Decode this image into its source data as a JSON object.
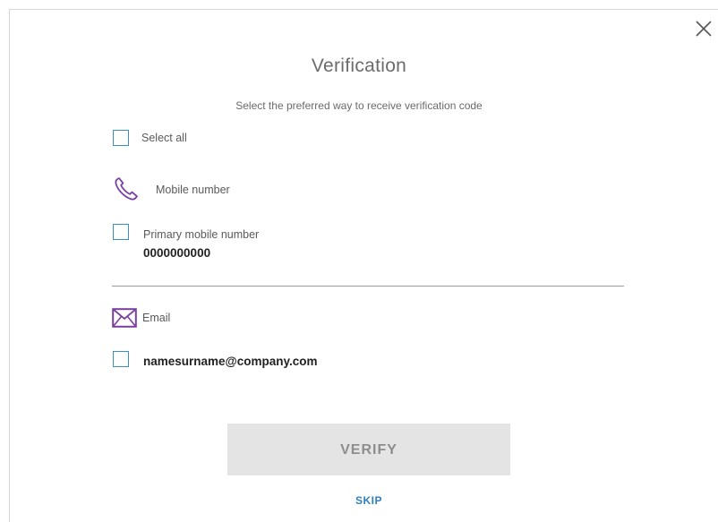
{
  "dialog": {
    "title": "Verification",
    "subtitle": "Select the preferred way to receive verification code",
    "close_icon": "close-icon"
  },
  "select_all": {
    "label": "Select all",
    "checked": false
  },
  "mobile_section": {
    "icon": "phone-icon",
    "label": "Mobile number",
    "options": [
      {
        "label": "Primary mobile number",
        "value": "0000000000",
        "checked": false
      }
    ]
  },
  "email_section": {
    "icon": "envelope-icon",
    "label": "Email",
    "options": [
      {
        "value": "namesurname@company.com",
        "checked": false
      }
    ]
  },
  "actions": {
    "verify_label": "VERIFY",
    "skip_label": "SKIP"
  },
  "colors": {
    "accent": "#3a8fc8",
    "icon": "#7a3fa0",
    "button_bg": "#e4e4e4",
    "button_text": "#8d8d8d",
    "link": "#2f7fbd"
  }
}
